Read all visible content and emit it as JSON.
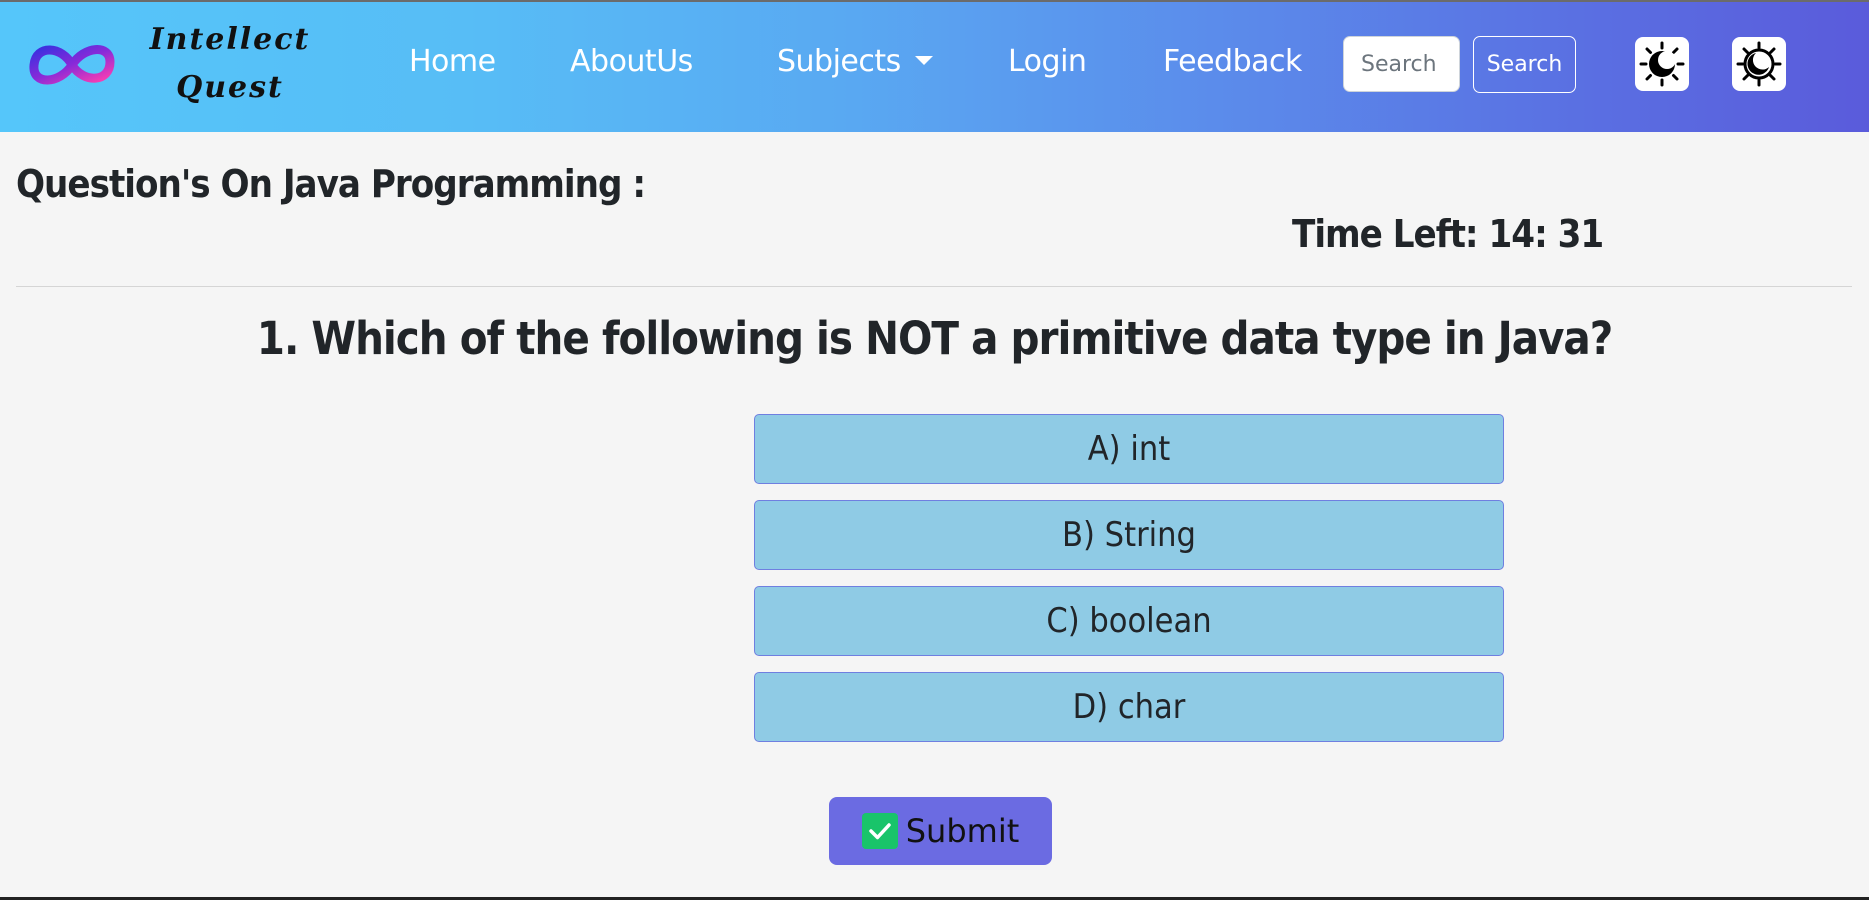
{
  "brand": {
    "line1": "Intellect",
    "line2": "Quest",
    "logo_icon": "infinity-logo-icon"
  },
  "nav": {
    "home": "Home",
    "about": "AboutUs",
    "subjects": "Subjects",
    "login": "Login",
    "feedback": "Feedback"
  },
  "search": {
    "placeholder": "Search",
    "button_label": "Search"
  },
  "theme_icons": [
    "light-mode-icon",
    "dark-mode-icon"
  ],
  "quiz": {
    "heading": "Question's On Java Programming :",
    "timer": "Time Left: 14: 31",
    "question": "1. Which of the following is NOT a primitive data type in Java?",
    "options": [
      "A) int",
      "B) String",
      "C) boolean",
      "D) char"
    ],
    "submit_label": "Submit"
  },
  "colors": {
    "nav_gradient_start": "#55c6fa",
    "nav_gradient_end": "#5a5bdb",
    "option_bg": "#8fcbe5",
    "submit_bg": "#6b6be2",
    "check_green": "#19c46a"
  }
}
